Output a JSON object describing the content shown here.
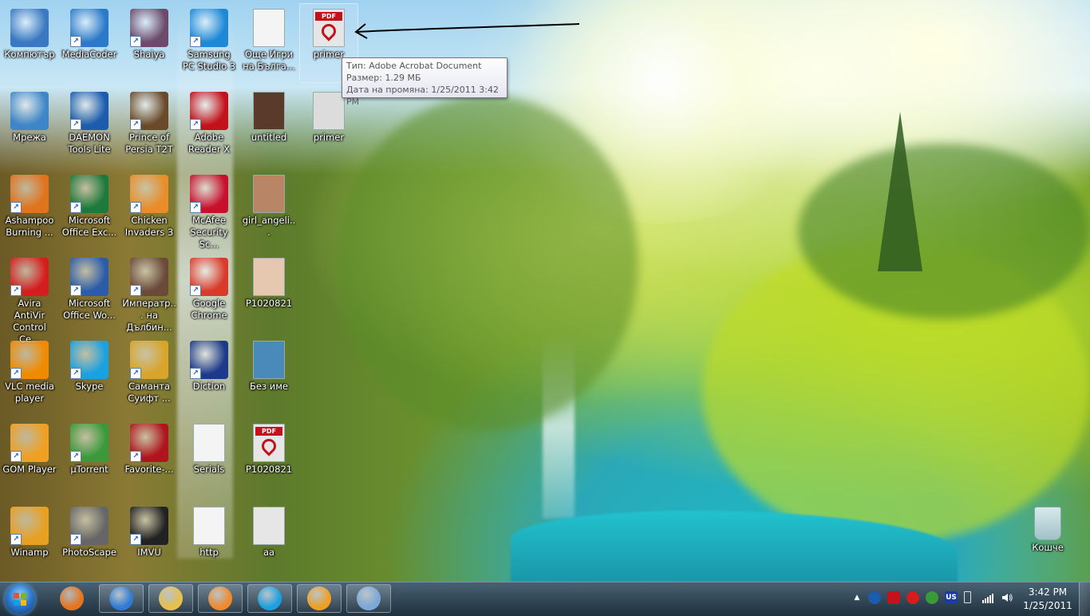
{
  "desktop_icons": [
    {
      "label": "Компютър",
      "icon": "computer-icon",
      "color": "#3a78c2"
    },
    {
      "label": "MediaCoder",
      "icon": "mediacoder-icon",
      "color": "#2c79c9"
    },
    {
      "label": "Shaiya",
      "icon": "shaiya-icon",
      "color": "#6b4a6b"
    },
    {
      "label": "Samsung PC Studio 3",
      "icon": "samsung-pc-studio-icon",
      "color": "#1e88d6"
    },
    {
      "label": "Още Игри на Бълга...",
      "icon": "blank-document-icon",
      "color": "#f4f4f4"
    },
    {
      "label": "primer",
      "icon": "pdf-document-icon",
      "color": "#e6e6e6"
    },
    {
      "label": "Мрежа",
      "icon": "network-icon",
      "color": "#3f86c9"
    },
    {
      "label": "DAEMON Tools Lite",
      "icon": "daemon-tools-icon",
      "color": "#1b5cae"
    },
    {
      "label": "Prince of Persia T2T",
      "icon": "prince-of-persia-icon",
      "color": "#6a4a2a"
    },
    {
      "label": "Adobe Reader X",
      "icon": "adobe-reader-icon",
      "color": "#c3121b"
    },
    {
      "label": "untitled",
      "icon": "photo-thumbnail-icon",
      "color": "#5a3a2a"
    },
    {
      "label": "primer",
      "icon": "image-thumbnail-icon",
      "color": "#dcdcdc"
    },
    {
      "label": "Ashampoo Burning ...",
      "icon": "ashampoo-icon",
      "color": "#e0731d"
    },
    {
      "label": "Microsoft Office Exc...",
      "icon": "excel-icon",
      "color": "#1e7a3c"
    },
    {
      "label": "Chicken Invaders 3",
      "icon": "chicken-invaders-icon",
      "color": "#e88d2a"
    },
    {
      "label": "McAfee Security Sc...",
      "icon": "mcafee-icon",
      "color": "#c8102e"
    },
    {
      "label": "girl_angeli...",
      "icon": "photo-thumbnail-icon",
      "color": "#b88666"
    },
    {
      "label": "Avira AntiVir Control Ce...",
      "icon": "avira-icon",
      "color": "#d51d1d"
    },
    {
      "label": "Microsoft Office Wo...",
      "icon": "word-icon",
      "color": "#2a5caa"
    },
    {
      "label": "Императр... на Дълбин...",
      "icon": "game-icon",
      "color": "#6b4a3a"
    },
    {
      "label": "Google Chrome",
      "icon": "chrome-icon",
      "color": "#d93b2b"
    },
    {
      "label": "P1020821",
      "icon": "photo-thumbnail-icon",
      "color": "#e6c8b0"
    },
    {
      "label": "VLC media player",
      "icon": "vlc-icon",
      "color": "#f08a00"
    },
    {
      "label": "Skype",
      "icon": "skype-icon",
      "color": "#1aa1e1"
    },
    {
      "label": "Саманта Суифт ...",
      "icon": "game-icon",
      "color": "#d8a42a"
    },
    {
      "label": "Diction",
      "icon": "uk-flag-icon",
      "color": "#1d3a8a"
    },
    {
      "label": "Без име",
      "icon": "image-thumbnail-icon",
      "color": "#4a8aba"
    },
    {
      "label": "GOM Player",
      "icon": "gom-player-icon",
      "color": "#f0a020"
    },
    {
      "label": "µTorrent",
      "icon": "utorrent-icon",
      "color": "#3a9a3a"
    },
    {
      "label": "Favorite-...",
      "icon": "dice-icon",
      "color": "#b0141c"
    },
    {
      "label": "Serials",
      "icon": "word-document-icon",
      "color": "#f4f4f4"
    },
    {
      "label": "P1020821",
      "icon": "pdf-document-icon",
      "color": "#e6e6e6"
    },
    {
      "label": "Winamp",
      "icon": "winamp-icon",
      "color": "#e8a020"
    },
    {
      "label": "PhotoScape",
      "icon": "photoscape-icon",
      "color": "#666666"
    },
    {
      "label": "IMVU",
      "icon": "imvu-icon",
      "color": "#222222"
    },
    {
      "label": "http",
      "icon": "word-document-icon",
      "color": "#f4f4f4"
    },
    {
      "label": "aa",
      "icon": "image-thumbnail-icon",
      "color": "#e6e6e6"
    }
  ],
  "recycle_bin": {
    "label": "Кошче",
    "icon": "recycle-bin-icon"
  },
  "tooltip": {
    "type_line": "Тип: Adobe Acrobat Document",
    "size_line": "Размер: 1.29 МБ",
    "modified_line": "Дата на промяна: 1/25/2011 3:42 PM"
  },
  "pdf_badge": "PDF",
  "taskbar": {
    "pinned": [
      {
        "name": "firefox-icon",
        "color": "#e8731d"
      },
      {
        "name": "internet-explorer-icon",
        "color": "#2f7bd6"
      },
      {
        "name": "windows-explorer-icon",
        "color": "#e8c04a"
      },
      {
        "name": "media-player-icon",
        "color": "#f08a2a"
      },
      {
        "name": "skype-icon",
        "color": "#1aa1e1"
      },
      {
        "name": "gom-player-icon",
        "color": "#f0a020"
      },
      {
        "name": "paint-icon",
        "color": "#7aa8d8"
      }
    ],
    "tray": {
      "language": "US",
      "time": "3:42 PM",
      "date": "1/25/2011"
    }
  }
}
